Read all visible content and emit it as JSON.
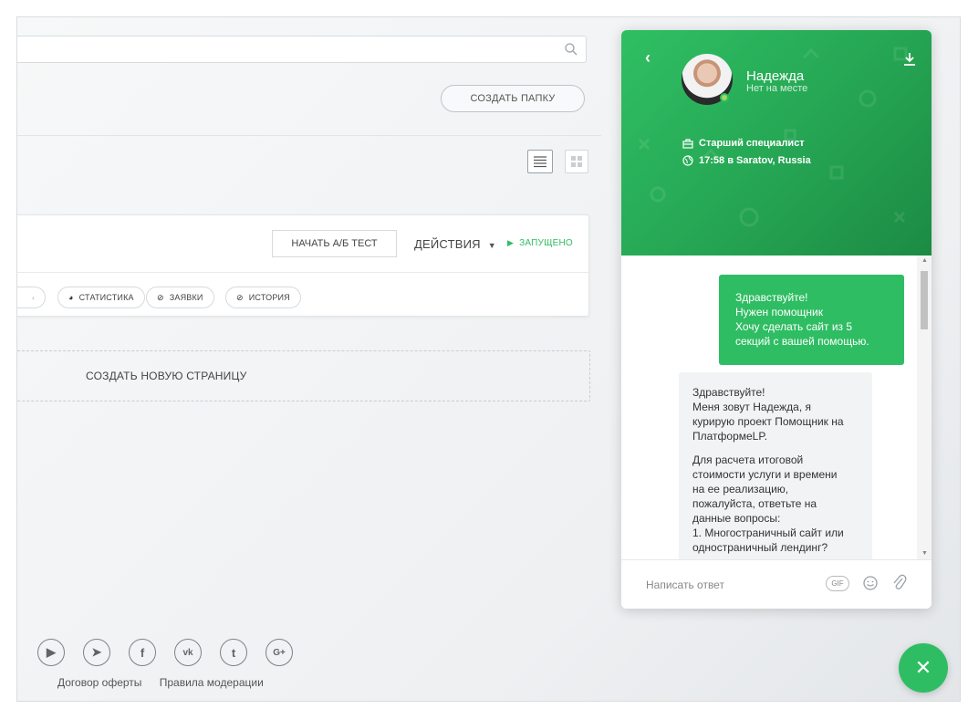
{
  "toolbar": {
    "create_folder": "СОЗДАТЬ ПАПКУ"
  },
  "project": {
    "ab_test": "НАЧАТЬ А/Б ТЕСТ",
    "actions": "ДЕЙСТВИЯ",
    "status": "ЗАПУЩЕНО",
    "tabs": [
      {
        "label": "СТАТИСТИКА",
        "icon": "pie-chart-icon"
      },
      {
        "label": "ЗАЯВКИ",
        "icon": "check-circle-icon"
      },
      {
        "label": "ИСТОРИЯ",
        "icon": "clock-icon"
      }
    ]
  },
  "create_page": "СОЗДАТЬ НОВУЮ СТРАНИЦУ",
  "footer": {
    "socials": [
      "youtube-icon",
      "telegram-icon",
      "facebook-icon",
      "vk-icon",
      "twitter-icon",
      "google-plus-icon"
    ],
    "links": [
      "Договор оферты",
      "Правила модерации"
    ]
  },
  "chat": {
    "agent_name": "Надежда",
    "agent_status": "Нет на месте",
    "role": "Старший специалист",
    "local_time": "17:58 в Saratov, Russia",
    "outgoing": [
      "Здравствуйте!",
      "Нужен помощник",
      "Хочу сделать сайт из 5",
      "секций с вашей помощью."
    ],
    "incoming_p1": [
      "Здравствуйте!",
      "Меня зовут Надежда, я",
      "курирую проект Помощник на",
      "ПлатформеLP."
    ],
    "incoming_p2": [
      "Для расчета итоговой",
      "стоимости услуги и времени",
      "на ее реализацию,",
      "пожалуйста, ответьте на",
      "данные вопросы:",
      "1. Многостраничный сайт или",
      "одностраничный лендинг?"
    ],
    "composer_placeholder": "Написать ответ",
    "gif_label": "GIF"
  },
  "colors": {
    "accent": "#2fbd63",
    "header_dark": "#1c8b44"
  }
}
